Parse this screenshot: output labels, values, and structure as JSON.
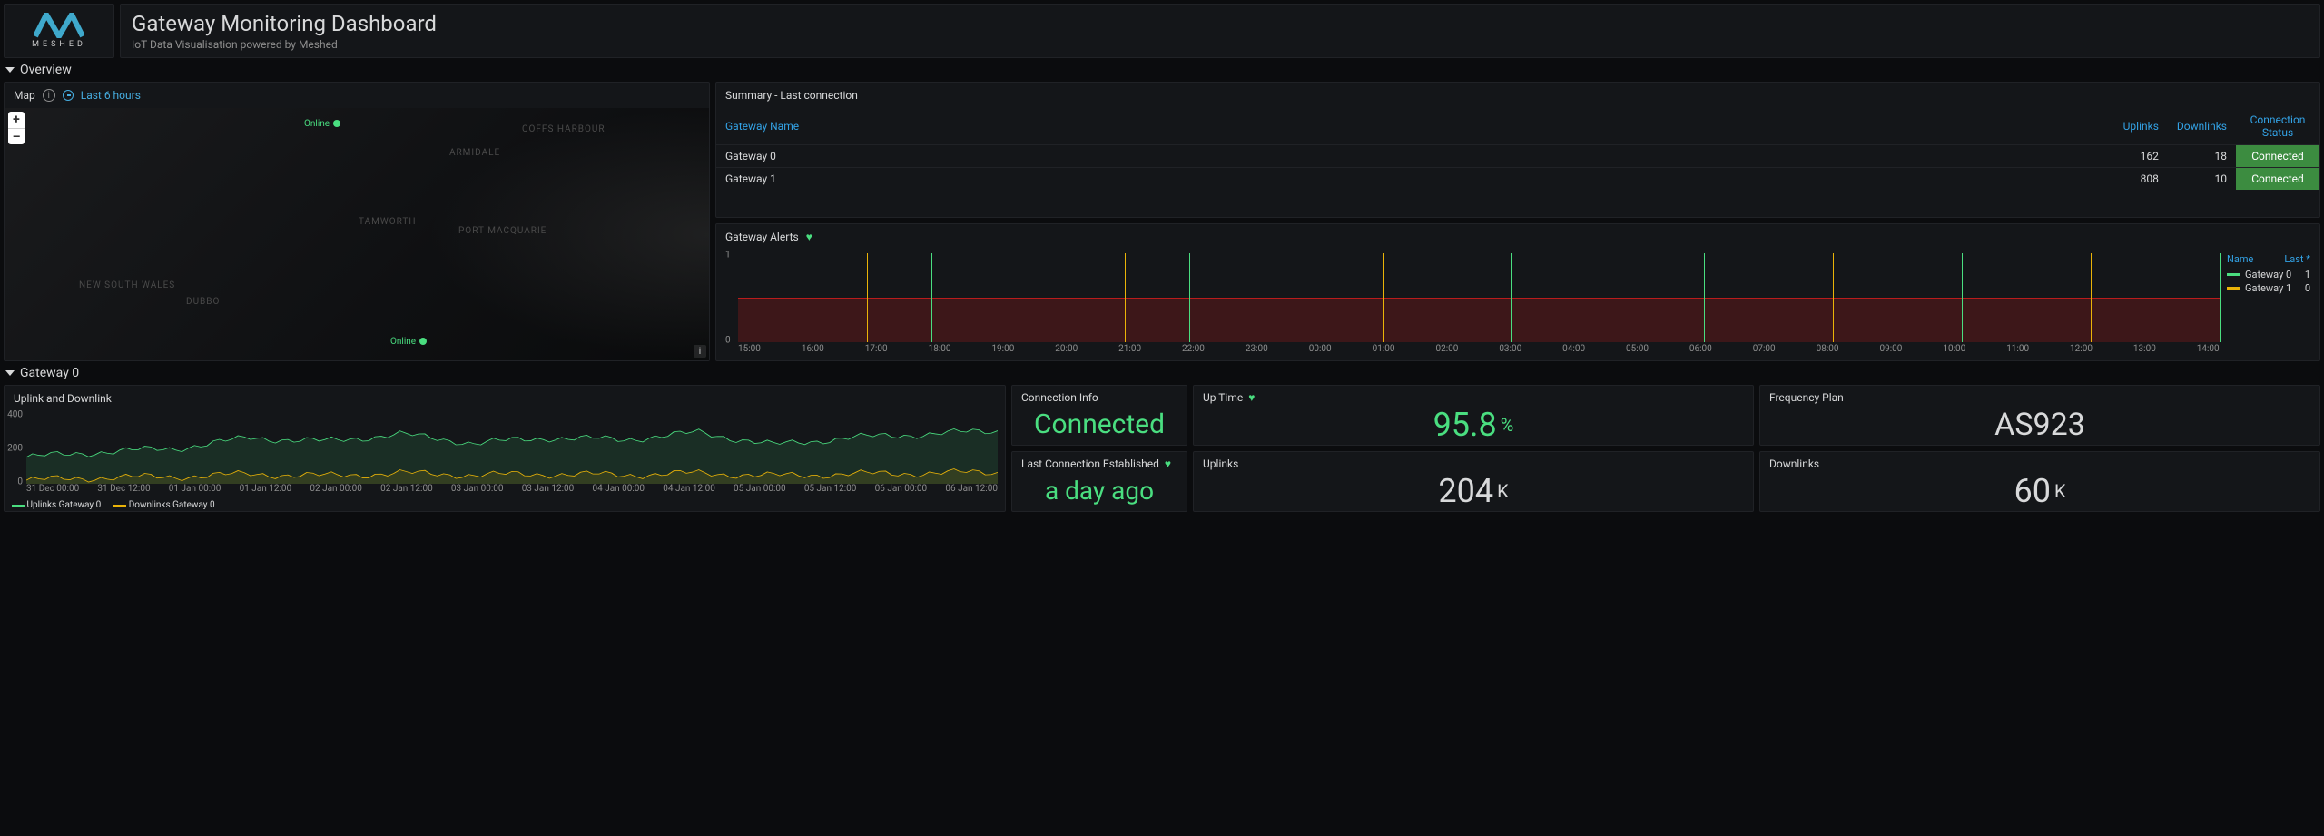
{
  "logo": {
    "text": "MESHED"
  },
  "header": {
    "title": "Gateway Monitoring Dashboard",
    "subtitle": "IoT Data Visualisation powered by Meshed"
  },
  "sections": {
    "overview": "Overview",
    "gateway0": "Gateway 0"
  },
  "map": {
    "title": "Map",
    "time_range": "Last 6 hours",
    "zoom_in": "+",
    "zoom_out": "–",
    "attrib": "i",
    "online_label": "Online",
    "labels": [
      "NEW SOUTH WALES",
      "ARMIDALE",
      "COFFS HARBOUR",
      "TAMWORTH",
      "PORT MACQUARIE",
      "DUBBO"
    ]
  },
  "summary": {
    "title": "Summary - Last connection",
    "columns": [
      "Gateway Name",
      "Uplinks",
      "Downlinks",
      "Connection Status"
    ],
    "rows": [
      {
        "name": "Gateway 0",
        "uplinks": "162",
        "downlinks": "18",
        "status": "Connected"
      },
      {
        "name": "Gateway 1",
        "uplinks": "808",
        "downlinks": "10",
        "status": "Connected"
      }
    ]
  },
  "alerts": {
    "title": "Gateway Alerts",
    "legend_headers": [
      "Name",
      "Last *"
    ],
    "series": [
      {
        "name": "Gateway 0",
        "color": "#4ade80",
        "last": "1"
      },
      {
        "name": "Gateway 1",
        "color": "#eab308",
        "last": "0"
      }
    ],
    "y_ticks": [
      "1",
      "0"
    ],
    "x_ticks": [
      "15:00",
      "16:00",
      "17:00",
      "18:00",
      "19:00",
      "20:00",
      "21:00",
      "22:00",
      "23:00",
      "00:00",
      "01:00",
      "02:00",
      "03:00",
      "04:00",
      "05:00",
      "06:00",
      "07:00",
      "08:00",
      "09:00",
      "10:00",
      "11:00",
      "12:00",
      "13:00",
      "14:00"
    ]
  },
  "chart_data": {
    "alerts": {
      "type": "line",
      "x": [
        "15:00",
        "16:00",
        "17:00",
        "18:00",
        "19:00",
        "20:00",
        "21:00",
        "22:00",
        "23:00",
        "00:00",
        "01:00",
        "02:00",
        "03:00",
        "04:00",
        "05:00",
        "06:00",
        "07:00",
        "08:00",
        "09:00",
        "10:00",
        "11:00",
        "12:00",
        "13:00",
        "14:00"
      ],
      "ylim": [
        0,
        1
      ],
      "series": [
        {
          "name": "Gateway 0",
          "color": "#4ade80",
          "values": [
            0,
            1,
            0,
            1,
            0,
            0,
            0,
            1,
            0,
            0,
            0,
            0,
            1,
            0,
            0,
            1,
            0,
            0,
            0,
            1,
            0,
            0,
            0,
            1
          ]
        },
        {
          "name": "Gateway 1",
          "color": "#eab308",
          "values": [
            0,
            0,
            1,
            0,
            0,
            0,
            1,
            0,
            0,
            0,
            1,
            0,
            0,
            0,
            1,
            0,
            0,
            1,
            0,
            0,
            0,
            1,
            0,
            0
          ]
        }
      ]
    },
    "uplink_downlink": {
      "type": "line",
      "title": "Uplink and Downlink",
      "ylabel": "",
      "ylim": [
        0,
        400
      ],
      "x": [
        "31 Dec 00:00",
        "31 Dec 12:00",
        "01 Jan 00:00",
        "01 Jan 12:00",
        "02 Jan 00:00",
        "02 Jan 12:00",
        "03 Jan 00:00",
        "03 Jan 12:00",
        "04 Jan 00:00",
        "04 Jan 12:00",
        "05 Jan 00:00",
        "05 Jan 12:00",
        "06 Jan 00:00",
        "06 Jan 12:00"
      ],
      "series": [
        {
          "name": "Uplinks Gateway 0",
          "color": "#4ade80",
          "values": [
            150,
            180,
            200,
            260,
            240,
            280,
            230,
            260,
            250,
            290,
            220,
            260,
            280,
            300
          ]
        },
        {
          "name": "Downlinks Gateway 0",
          "color": "#eab308",
          "values": [
            20,
            35,
            40,
            55,
            45,
            60,
            50,
            55,
            50,
            60,
            45,
            55,
            60,
            65
          ]
        }
      ]
    }
  },
  "uplink_downlink": {
    "title": "Uplink and Downlink",
    "y_ticks": [
      "400",
      "200",
      "0"
    ],
    "x_ticks": [
      "31 Dec 00:00",
      "31 Dec 12:00",
      "01 Jan 00:00",
      "01 Jan 12:00",
      "02 Jan 00:00",
      "02 Jan 12:00",
      "03 Jan 00:00",
      "03 Jan 12:00",
      "04 Jan 00:00",
      "04 Jan 12:00",
      "05 Jan 00:00",
      "05 Jan 12:00",
      "06 Jan 00:00",
      "06 Jan 12:00"
    ],
    "legend": [
      {
        "name": "Uplinks Gateway 0",
        "color": "#4ade80"
      },
      {
        "name": "Downlinks Gateway 0",
        "color": "#eab308"
      }
    ]
  },
  "stats": {
    "connection_info": {
      "title": "Connection Info",
      "value": "Connected"
    },
    "last_connection": {
      "title": "Last Connection Established",
      "value": "a day ago"
    },
    "uptime": {
      "title": "Up Time",
      "value": "95.8",
      "unit": "%"
    },
    "uplinks": {
      "title": "Uplinks",
      "value": "204",
      "unit": "K"
    },
    "freq_plan": {
      "title": "Frequency Plan",
      "value": "AS923"
    },
    "downlinks": {
      "title": "Downlinks",
      "value": "60",
      "unit": "K"
    }
  }
}
